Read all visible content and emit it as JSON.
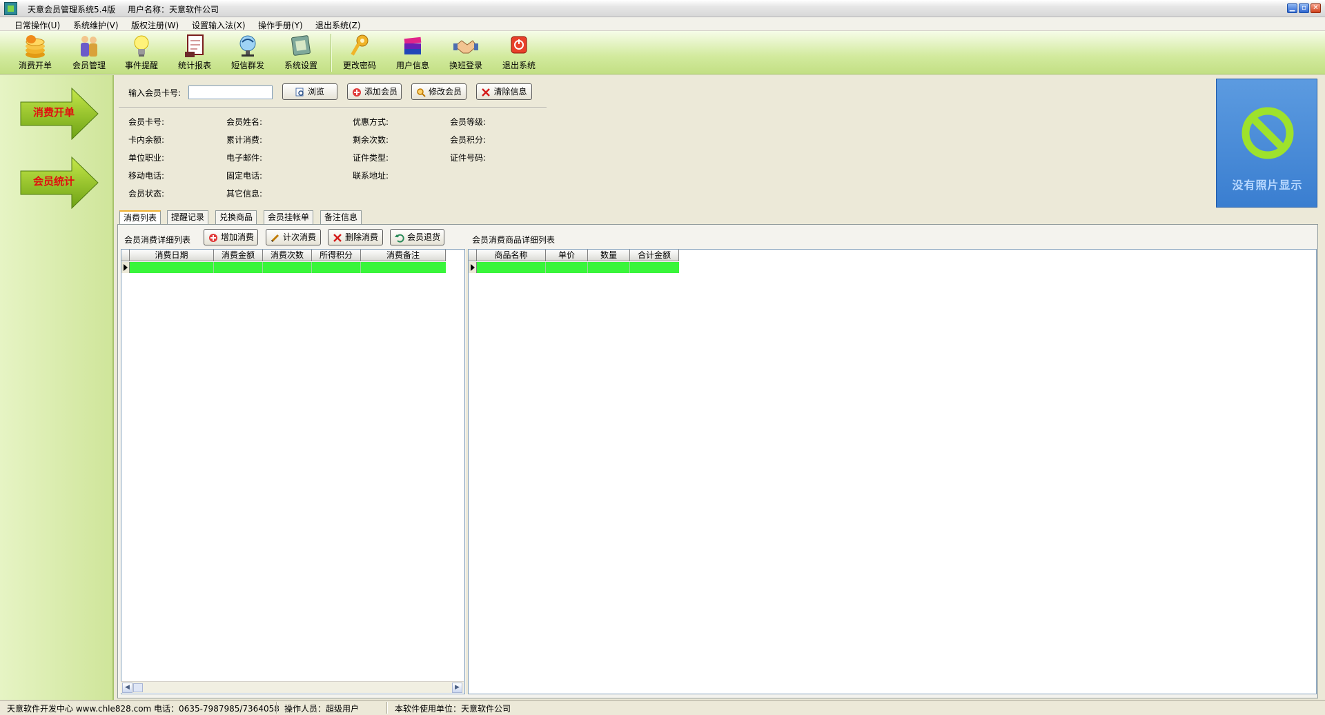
{
  "window": {
    "title": "天意会员管理系统5.4版",
    "user_label": "用户名称：天意软件公司"
  },
  "menu": [
    "日常操作(U)",
    "系统维护(V)",
    "版权注册(W)",
    "设置输入法(X)",
    "操作手册(Y)",
    "退出系统(Z)"
  ],
  "toolbar": [
    {
      "label": "消费开单",
      "icon": "coins-icon"
    },
    {
      "label": "会员管理",
      "icon": "members-icon"
    },
    {
      "label": "事件提醒",
      "icon": "lightbulb-icon"
    },
    {
      "label": "统计报表",
      "icon": "report-icon"
    },
    {
      "label": "短信群发",
      "icon": "satellite-icon"
    },
    {
      "label": "系统设置",
      "icon": "settings-icon"
    },
    {
      "label": "更改密码",
      "icon": "key-icon"
    },
    {
      "label": "用户信息",
      "icon": "books-icon"
    },
    {
      "label": "换班登录",
      "icon": "handshake-icon"
    },
    {
      "label": "退出系统",
      "icon": "power-icon"
    }
  ],
  "sidebar": [
    "消费开单",
    "会员统计"
  ],
  "search": {
    "label": "输入会员卡号:",
    "value": "",
    "browse": "浏览",
    "add": "添加会员",
    "edit": "修改会员",
    "clear": "清除信息"
  },
  "fields": {
    "col1": [
      "会员卡号:",
      "卡内余额:",
      "单位职业:",
      "移动电话:",
      "会员状态:"
    ],
    "col2": [
      "会员姓名:",
      "累计消费:",
      "电子邮件:",
      "固定电话:",
      "其它信息:"
    ],
    "col3": [
      "优惠方式:",
      "剩余次数:",
      "证件类型:",
      "联系地址:"
    ],
    "col4": [
      "会员等级:",
      "会员积分:",
      "证件号码:"
    ]
  },
  "photo_text": "没有照片显示",
  "tabs": [
    "消费列表",
    "提醒记录",
    "兑换商品",
    "会员挂帐单",
    "备注信息"
  ],
  "consume": {
    "title": "会员消费详细列表",
    "add": "增加消费",
    "count": "计次消费",
    "delete": "删除消费",
    "refund": "会员退货",
    "columns": [
      "消费日期",
      "消费金额",
      "消费次数",
      "所得积分",
      "消费备注"
    ]
  },
  "goods": {
    "title": "会员消费商品详细列表",
    "columns": [
      "商品名称",
      "单价",
      "数量",
      "合计金额"
    ]
  },
  "status": {
    "dev": "天意软件开发中心 www.chle828.com 电话：0635-7987985/7364058",
    "operator": "操作人员：超级用户",
    "unit": "本软件使用单位：天意软件公司"
  },
  "colors": {
    "toolbar": "#d2ea9d",
    "selected_row": "#39f53b",
    "sidebar_label": "#e01010",
    "photo_bg": "#3a7ed0"
  }
}
